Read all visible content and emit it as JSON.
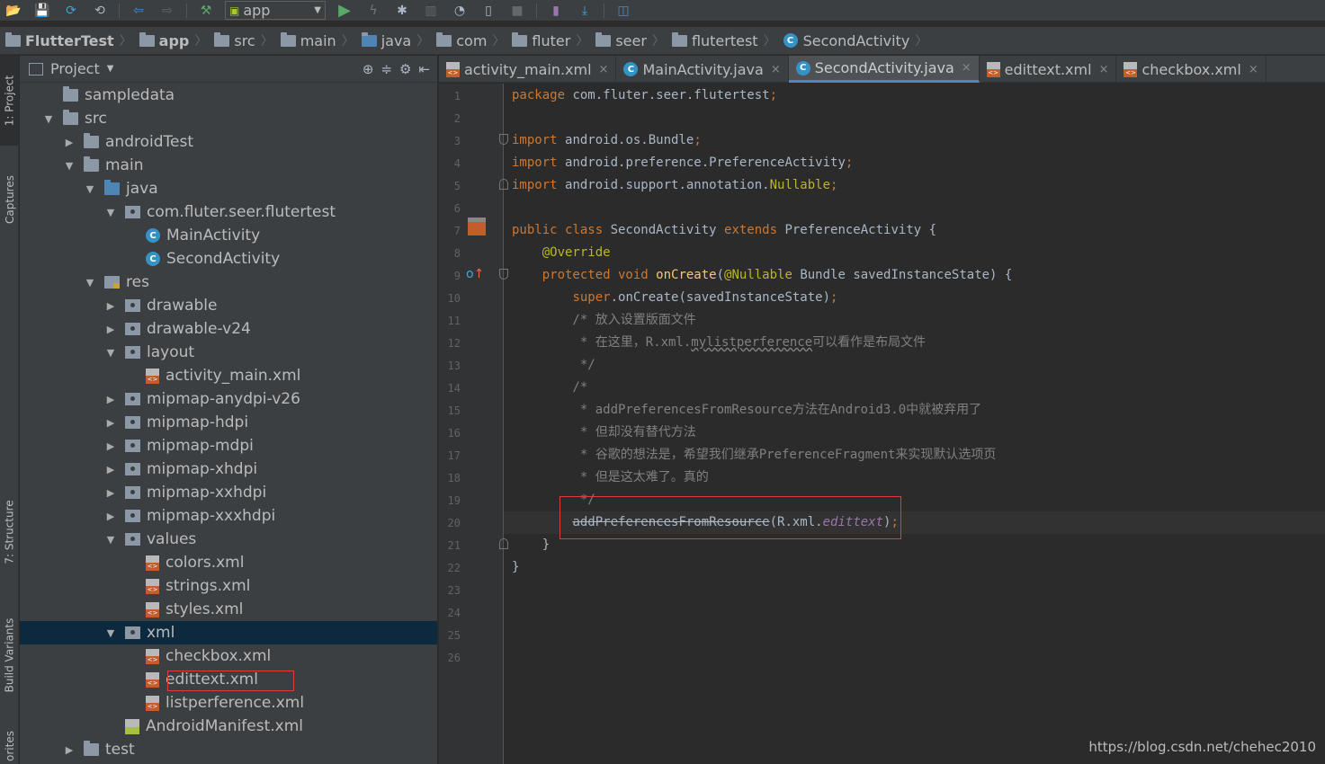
{
  "toolbar": {
    "run_config": "app",
    "icons": [
      "open-folder-icon",
      "save-icon",
      "sync-icon",
      "sync-files-icon",
      "back-icon",
      "forward-icon",
      "build-hammer-icon",
      "run-icon",
      "apply-changes-icon",
      "debug-icon",
      "profile-icon",
      "attach-debugger-icon",
      "avd-icon",
      "stop-icon",
      "sdk-manager-icon",
      "download-icon",
      "layout-inspector-icon"
    ]
  },
  "breadcrumb": [
    {
      "label": "FlutterTest",
      "bold": true
    },
    {
      "label": "app",
      "bold": true
    },
    {
      "label": "src"
    },
    {
      "label": "main"
    },
    {
      "label": "java"
    },
    {
      "label": "com"
    },
    {
      "label": "fluter"
    },
    {
      "label": "seer"
    },
    {
      "label": "flutertest"
    },
    {
      "label": "SecondActivity",
      "icon": "class"
    }
  ],
  "side_tabs": {
    "project": "1: Project",
    "captures": "Captures",
    "structure": "7: Structure",
    "build_variants": "Build Variants",
    "favorites": "orites"
  },
  "project_panel": {
    "title": "Project",
    "tree": [
      {
        "label": "sampledata",
        "icon": "folder",
        "depth": 1,
        "toggle": ""
      },
      {
        "label": "src",
        "icon": "folder",
        "depth": 1,
        "toggle": "▼"
      },
      {
        "label": "androidTest",
        "icon": "folder",
        "depth": 2,
        "toggle": "▶"
      },
      {
        "label": "main",
        "icon": "folder",
        "depth": 2,
        "toggle": "▼"
      },
      {
        "label": "java",
        "icon": "srcf",
        "depth": 3,
        "toggle": "▼"
      },
      {
        "label": "com.fluter.seer.flutertest",
        "icon": "pkg",
        "depth": 4,
        "toggle": "▼"
      },
      {
        "label": "MainActivity",
        "icon": "cls",
        "depth": 5,
        "toggle": ""
      },
      {
        "label": "SecondActivity",
        "icon": "cls",
        "depth": 5,
        "toggle": ""
      },
      {
        "label": "res",
        "icon": "resf",
        "depth": 3,
        "toggle": "▼"
      },
      {
        "label": "drawable",
        "icon": "pkg",
        "depth": 4,
        "toggle": "▶"
      },
      {
        "label": "drawable-v24",
        "icon": "pkg",
        "depth": 4,
        "toggle": "▶"
      },
      {
        "label": "layout",
        "icon": "pkg",
        "depth": 4,
        "toggle": "▼"
      },
      {
        "label": "activity_main.xml",
        "icon": "xml",
        "depth": 5,
        "toggle": ""
      },
      {
        "label": "mipmap-anydpi-v26",
        "icon": "pkg",
        "depth": 4,
        "toggle": "▶"
      },
      {
        "label": "mipmap-hdpi",
        "icon": "pkg",
        "depth": 4,
        "toggle": "▶"
      },
      {
        "label": "mipmap-mdpi",
        "icon": "pkg",
        "depth": 4,
        "toggle": "▶"
      },
      {
        "label": "mipmap-xhdpi",
        "icon": "pkg",
        "depth": 4,
        "toggle": "▶"
      },
      {
        "label": "mipmap-xxhdpi",
        "icon": "pkg",
        "depth": 4,
        "toggle": "▶"
      },
      {
        "label": "mipmap-xxxhdpi",
        "icon": "pkg",
        "depth": 4,
        "toggle": "▶"
      },
      {
        "label": "values",
        "icon": "pkg",
        "depth": 4,
        "toggle": "▼"
      },
      {
        "label": "colors.xml",
        "icon": "xml",
        "depth": 5,
        "toggle": ""
      },
      {
        "label": "strings.xml",
        "icon": "xml",
        "depth": 5,
        "toggle": ""
      },
      {
        "label": "styles.xml",
        "icon": "xml",
        "depth": 5,
        "toggle": ""
      },
      {
        "label": "xml",
        "icon": "pkg",
        "depth": 4,
        "toggle": "▼",
        "selected": true
      },
      {
        "label": "checkbox.xml",
        "icon": "xml",
        "depth": 5,
        "toggle": ""
      },
      {
        "label": "edittext.xml",
        "icon": "xml",
        "depth": 5,
        "toggle": "",
        "boxed": true
      },
      {
        "label": "listperference.xml",
        "icon": "xml",
        "depth": 5,
        "toggle": ""
      },
      {
        "label": "AndroidManifest.xml",
        "icon": "manif",
        "depth": 4,
        "toggle": ""
      },
      {
        "label": "test",
        "icon": "folder",
        "depth": 2,
        "toggle": "▶"
      }
    ]
  },
  "editor_tabs": [
    {
      "label": "activity_main.xml",
      "icon": "xml"
    },
    {
      "label": "MainActivity.java",
      "icon": "cls"
    },
    {
      "label": "SecondActivity.java",
      "icon": "cls",
      "active": true
    },
    {
      "label": "edittext.xml",
      "icon": "xml"
    },
    {
      "label": "checkbox.xml",
      "icon": "xml"
    }
  ],
  "code": {
    "line_numbers": [
      "1",
      "2",
      "3",
      "4",
      "5",
      "6",
      "7",
      "8",
      "9",
      "10",
      "11",
      "12",
      "13",
      "14",
      "15",
      "16",
      "17",
      "18",
      "19",
      "20",
      "21",
      "22",
      "23",
      "24",
      "25",
      "26"
    ],
    "current_line": 20,
    "lines": [
      [
        {
          "t": "package ",
          "c": "kw"
        },
        {
          "t": "com.fluter.seer.flutertest"
        },
        {
          "t": ";",
          "c": "kw"
        }
      ],
      [],
      [
        {
          "t": "import ",
          "c": "kw"
        },
        {
          "t": "android.os.Bundle"
        },
        {
          "t": ";",
          "c": "kw"
        }
      ],
      [
        {
          "t": "import ",
          "c": "kw"
        },
        {
          "t": "android.preference.PreferenceActivity"
        },
        {
          "t": ";",
          "c": "kw"
        }
      ],
      [
        {
          "t": "import ",
          "c": "kw"
        },
        {
          "t": "android.support.annotation."
        },
        {
          "t": "Nullable",
          "c": "an"
        },
        {
          "t": ";",
          "c": "kw"
        }
      ],
      [],
      [
        {
          "t": "public class ",
          "c": "kw"
        },
        {
          "t": "SecondActivity "
        },
        {
          "t": "extends ",
          "c": "kw"
        },
        {
          "t": "PreferenceActivity {"
        }
      ],
      [
        {
          "t": "    "
        },
        {
          "t": "@Override",
          "c": "an"
        }
      ],
      [
        {
          "t": "    "
        },
        {
          "t": "protected void ",
          "c": "kw"
        },
        {
          "t": "onCreate",
          "c": "fn"
        },
        {
          "t": "("
        },
        {
          "t": "@Nullable ",
          "c": "an"
        },
        {
          "t": "Bundle savedInstanceState) {"
        }
      ],
      [
        {
          "t": "        "
        },
        {
          "t": "super",
          "c": "kw"
        },
        {
          "t": ".onCreate(savedInstanceState)"
        },
        {
          "t": ";",
          "c": "kw"
        }
      ],
      [
        {
          "t": "        /* 放入设置版面文件",
          "c": "cm"
        }
      ],
      [
        {
          "t": "         * 在这里，R.xml.",
          "c": "cm"
        },
        {
          "t": "mylistperference",
          "c": "cm un"
        },
        {
          "t": "可以看作是布局文件",
          "c": "cm"
        }
      ],
      [
        {
          "t": "         */",
          "c": "cm"
        }
      ],
      [
        {
          "t": "        /*",
          "c": "cm"
        }
      ],
      [
        {
          "t": "         * addPreferencesFromResource方法在Android3.0中就被弃用了",
          "c": "cm"
        }
      ],
      [
        {
          "t": "         * 但却没有替代方法",
          "c": "cm"
        }
      ],
      [
        {
          "t": "         * 谷歌的想法是，希望我们继承PreferenceFragment来实现默认选项页",
          "c": "cm"
        }
      ],
      [
        {
          "t": "         * 但是这太难了。真的",
          "c": "cm"
        }
      ],
      [
        {
          "t": "         */",
          "c": "cm"
        }
      ],
      [
        {
          "t": "        "
        },
        {
          "t": "addPreferencesFromResource",
          "c": "st"
        },
        {
          "t": "(R.xml."
        },
        {
          "t": "edittext",
          "c": "it"
        },
        {
          "t": ")"
        },
        {
          "t": ";",
          "c": "kw"
        }
      ],
      [
        {
          "t": "    }"
        }
      ],
      [
        {
          "t": "}"
        }
      ],
      [],
      [],
      [],
      []
    ]
  },
  "watermark": "https://blog.csdn.net/chehec2010",
  "colors": {
    "keyword": "#cc7832",
    "annotation": "#bbb529",
    "method": "#ffc66d",
    "comment": "#808080",
    "field": "#9876aa",
    "highlight_box": "#e03a3a",
    "selection": "#0d293e",
    "active_tab_underline": "#4a88c7"
  }
}
